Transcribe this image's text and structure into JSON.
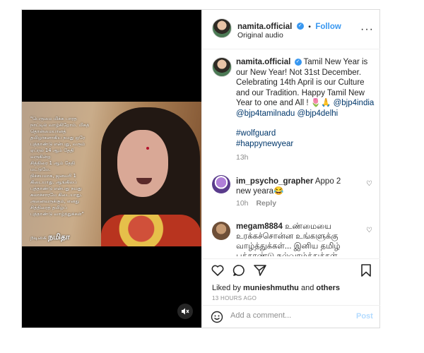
{
  "media": {
    "overlay_lines": [
      "\"பெருமை மிக்க பாரத",
      "நாட்டில் வாழ்கிறோம். மிகத்",
      "தொன்மையானத்",
      "தமிழர்களாகிய நமது ஒரே",
      "புத்தாண்டு என்பது, வரும்",
      "ஏப்ரல் 14 ஆம் தேதி",
      "வருகின்ற",
      "சித்திரை 1 ஆம் தேதி",
      "மட்டுமே.",
      "நிச்சயமாக, ஜனவரி 1",
      "கிடையாது. ஆங்கிலப்",
      "புத்தாண்டு என்பது நமது",
      "கலாச்சாரமே கிடையாது.",
      "அனைவருக்கும், எனது",
      "சித்திரைத் தமிழ்ப்",
      "புத்தாண்டு வாழ்த்துக்கள்\""
    ],
    "sign_prefix": "நடிகை",
    "sign_name": "நமிதா",
    "mute_icon": "speaker-muted-icon"
  },
  "header": {
    "username": "namita.official",
    "separator": "•",
    "follow_label": "Follow",
    "subtitle": "Original audio"
  },
  "caption": {
    "username": "namita.official",
    "text": "Tamil New Year is our New Year! Not 31st December. Celebrating 14th April is our Culture and our Tradition. Happy Tamil New Year to one and All !",
    "emoji": "🌷🙏",
    "mentions": [
      "@bjp4india",
      "@bjp4tamilnadu",
      "@bjp4delhi"
    ],
    "hashtags": [
      "#wolfguard",
      "#happynewyear"
    ],
    "time": "13h"
  },
  "comments": [
    {
      "username": "im_psycho_grapher",
      "text": "Appo 2 new yeara😂",
      "time": "10h",
      "reply_label": "Reply"
    },
    {
      "username": "megam8884",
      "text": "உண்மையை உரக்கச்சொன்ன உங்களுக்கு வாழ்த்துக்கள்... இனிய தமிழ் புத்தாண்டு நல்வாழ்த்துக்கள்"
    }
  ],
  "likes": {
    "prefix": "Liked by",
    "user": "munieshmuthu",
    "middle": "and",
    "others": "others"
  },
  "timestamp": "13 HOURS AGO",
  "composer": {
    "placeholder": "Add a comment...",
    "post_label": "Post"
  }
}
